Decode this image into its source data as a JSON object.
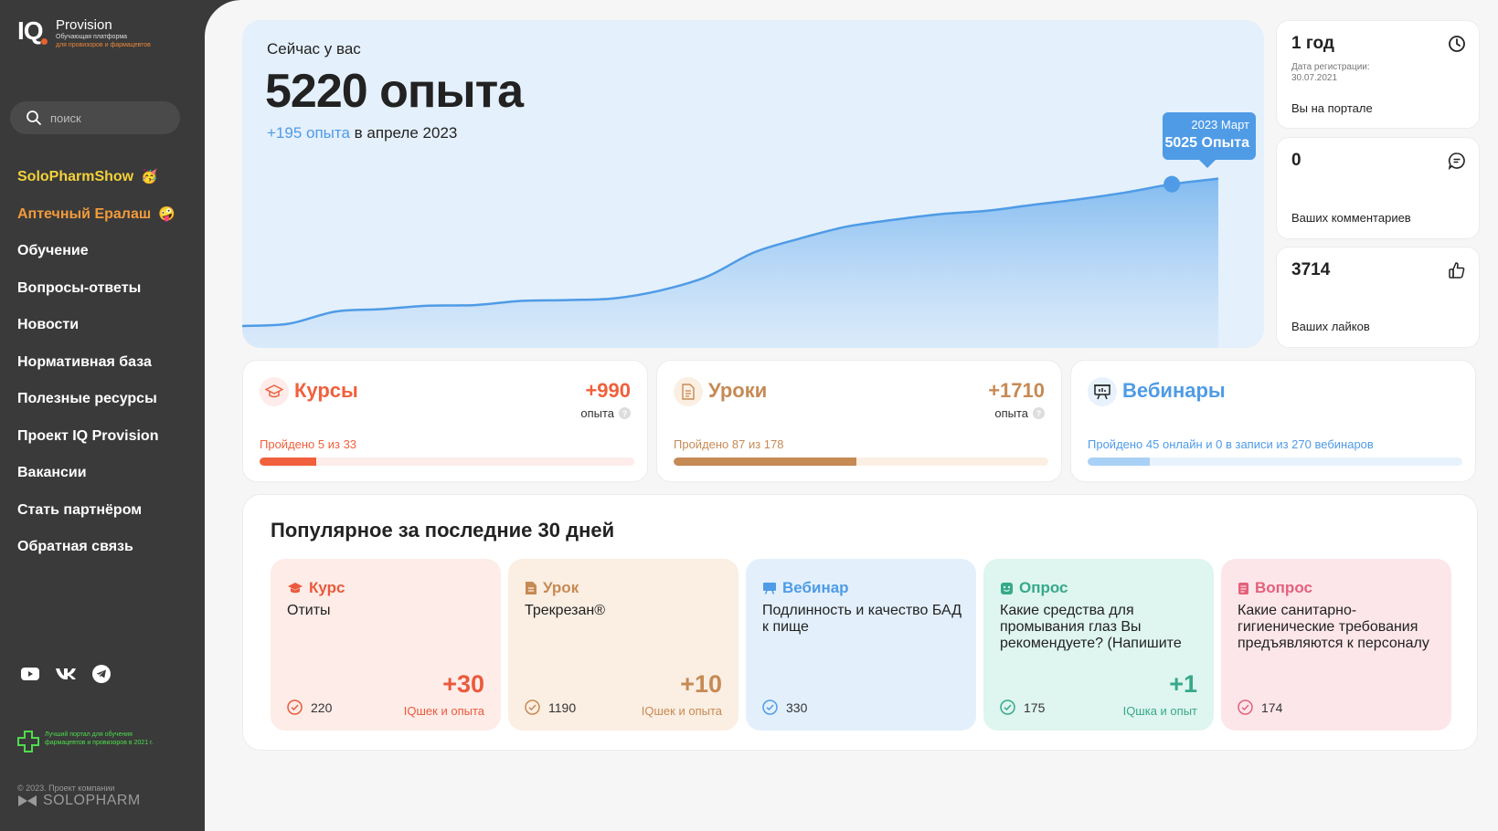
{
  "logo": {
    "mark": "IQ",
    "title": "Provision",
    "subtitle1": "Обучающая платформа",
    "subtitle2": "для провизоров и фармацевтов"
  },
  "search": {
    "placeholder": "поиск"
  },
  "nav": [
    {
      "label": "SoloPharmShow",
      "style": "yellow",
      "emoji": "🥳"
    },
    {
      "label": "Аптечный Ералаш",
      "style": "orange",
      "emoji": "🤪"
    },
    {
      "label": "Обучение",
      "style": "white"
    },
    {
      "label": "Вопросы-ответы",
      "style": "white"
    },
    {
      "label": "Новости",
      "style": "white"
    },
    {
      "label": "Нормативная база",
      "style": "white"
    },
    {
      "label": "Полезные ресурсы",
      "style": "white"
    },
    {
      "label": "Проект IQ Provision",
      "style": "white"
    },
    {
      "label": "Вакансии",
      "style": "white"
    },
    {
      "label": "Стать партнёром",
      "style": "white"
    },
    {
      "label": "Обратная связь",
      "style": "white"
    }
  ],
  "social": [
    "youtube-icon",
    "vk-icon",
    "telegram-icon"
  ],
  "award": {
    "text": "Лучший портал для обучения фармацевтов и провизоров в 2021 г."
  },
  "footer": {
    "copyright": "© 2023. Проект компании",
    "brand": "SOLOPHARM"
  },
  "hero": {
    "label": "Сейчас у вас",
    "value": "5220 опыта",
    "delta": "+195 опыта",
    "delta_suffix": " в апреле 2023",
    "tooltip_date": "2023 Март",
    "tooltip_value": "5025 Опыта"
  },
  "chart_data": {
    "type": "area",
    "title": "",
    "xlabel": "",
    "ylabel": "",
    "x": [
      "p01",
      "p02",
      "p03",
      "p04",
      "p05",
      "p06",
      "p07",
      "p08",
      "p09",
      "p10",
      "p11",
      "p12",
      "p13",
      "p14",
      "p15",
      "p16",
      "p17",
      "p18",
      "p19",
      "p20",
      "p21",
      "p22"
    ],
    "values": [
      0,
      80,
      510,
      600,
      720,
      740,
      890,
      920,
      980,
      1260,
      1750,
      2600,
      3100,
      3520,
      3760,
      3960,
      4080,
      4290,
      4490,
      4730,
      5025,
      5220
    ],
    "highlight_index": 20,
    "ylim": [
      0,
      5500
    ],
    "grid": false,
    "color": "#4f9be6"
  },
  "stats": [
    {
      "value": "1 год",
      "sub1": "Дата регистрации:",
      "sub2": "30.07.2021",
      "label": "Вы на портале",
      "icon": "clock-icon"
    },
    {
      "value": "0",
      "label": "Ваших комментариев",
      "icon": "comment-icon"
    },
    {
      "value": "3714",
      "label": "Ваших лайков",
      "icon": "thumb-up-icon"
    }
  ],
  "cards": [
    {
      "title": "Курсы",
      "points": "+990",
      "points_label": "опыта",
      "progress_text": "Пройдено 5 из 33",
      "progress": 0.152,
      "color": "#f0603c",
      "track": "#fdecea",
      "icon_bg": "#fdecea",
      "icon": "graduation-cap-icon"
    },
    {
      "title": "Уроки",
      "points": "+1710",
      "points_label": "опыта",
      "progress_text": "Пройдено 87 из 178",
      "progress": 0.489,
      "color": "#c68a55",
      "track": "#fbefe3",
      "icon_bg": "#fbefe3",
      "icon": "document-icon"
    },
    {
      "title": "Вебинары",
      "progress_text": "Пройдено 45 онлайн и 0 в записи из 270 вебинаров",
      "progress": 0.167,
      "color": "#a9d0f5",
      "track": "#e8f2fd",
      "icon_bg": "#e8f2fd",
      "text_color": "#4f9be6",
      "icon": "presentation-icon"
    }
  ],
  "popular": {
    "title": "Популярное за последние 30 дней",
    "items": [
      {
        "type": "Курс",
        "name": "Отиты",
        "count": "220",
        "points": "+30",
        "points_label": "IQшек и опыта",
        "bg": "#fdece7",
        "color": "#ea5a3d",
        "icon": "graduation-cap-icon"
      },
      {
        "type": "Урок",
        "name": "Трекрезан®",
        "count": "1190",
        "points": "+10",
        "points_label": "IQшек и опыта",
        "bg": "#fbeee2",
        "color": "#c68a55",
        "icon": "document-icon"
      },
      {
        "type": "Вебинар",
        "name": "Подлинность и качество БАД к пище",
        "count": "330",
        "bg": "#e3f0fc",
        "color": "#4f9be6",
        "icon": "presentation-icon"
      },
      {
        "type": "Опрос",
        "name": "Какие средства для промывания глаз Вы рекомендуете? (Напишите названия)",
        "count": "175",
        "points": "+1",
        "points_label": "IQшка и опыт",
        "bg": "#dff5ef",
        "color": "#36a98a",
        "icon": "smiley-icon"
      },
      {
        "type": "Вопрос",
        "name": "Какие санитарно-гигиенические требования предъявляются к персоналу аптеки?",
        "count": "174",
        "bg": "#fce6ea",
        "color": "#e4617a",
        "icon": "question-doc-icon"
      }
    ]
  }
}
